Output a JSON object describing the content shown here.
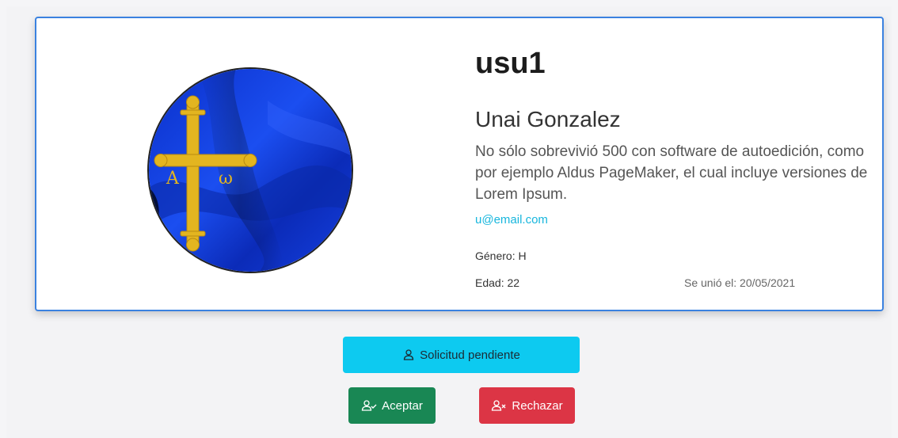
{
  "profile": {
    "username": "usu1",
    "full_name": "Unai Gonzalez",
    "bio": "No sólo sobrevivió 500 con software de autoedición, como por ejemplo Aldus PageMaker, el cual incluye versiones de Lorem Ipsum.",
    "email": "u@email.com",
    "gender": "Género: H",
    "age": "Edad: 22",
    "joined": "Se unió el: 20/05/2021",
    "avatar_icon": "asturias-flag-avatar"
  },
  "actions": {
    "pending_label": "Solicitud pendiente",
    "pending_icon": "person-icon",
    "accept_label": "Aceptar",
    "accept_icon": "person-check-icon",
    "reject_label": "Rechazar",
    "reject_icon": "person-x-icon"
  },
  "colors": {
    "card_border": "#3b82e0",
    "email": "#17b6dd",
    "pending_bg": "#0dcaf0",
    "accept_bg": "#198754",
    "reject_bg": "#dc3545"
  }
}
